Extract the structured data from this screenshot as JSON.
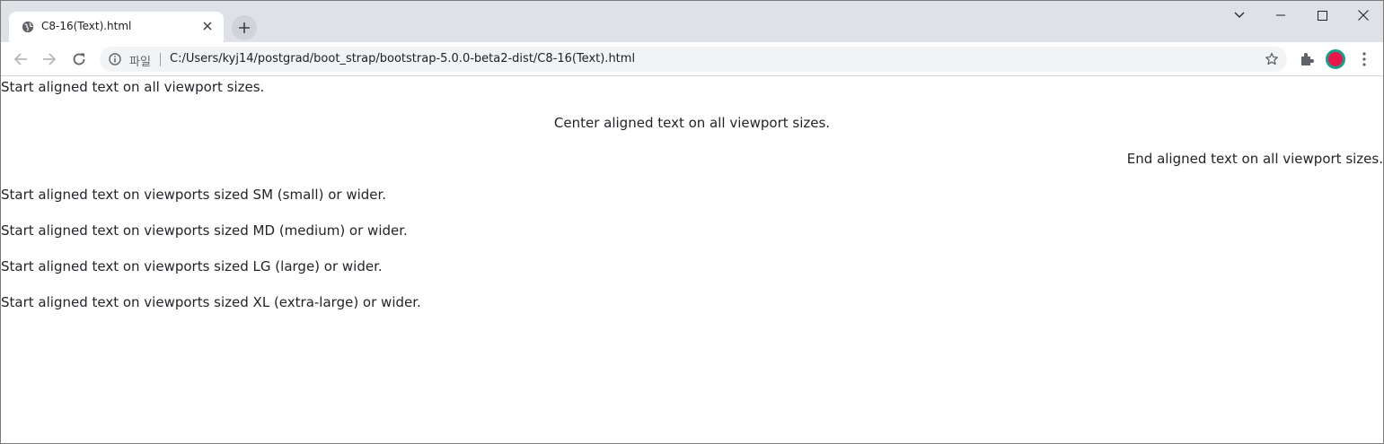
{
  "browser": {
    "tab": {
      "title": "C8-16(Text).html"
    },
    "address_bar": {
      "scheme_label": "파일",
      "url": "C:/Users/kyj14/postgrad/boot_strap/bootstrap-5.0.0-beta2-dist/C8-16(Text).html"
    }
  },
  "page": {
    "lines": [
      "Start aligned text on all viewport sizes.",
      "Center aligned text on all viewport sizes.",
      "End aligned text on all viewport sizes.",
      "Start aligned text on viewports sized SM (small) or wider.",
      "Start aligned text on viewports sized MD (medium) or wider.",
      "Start aligned text on viewports sized LG (large) or wider.",
      "Start aligned text on viewports sized XL (extra-large) or wider."
    ]
  },
  "colors": {
    "profile_ring": "#1a9e8a",
    "profile_fill": "#e8174b"
  }
}
